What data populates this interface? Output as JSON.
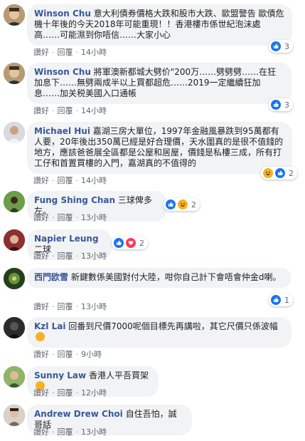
{
  "comments": [
    {
      "name": "Winson Chu",
      "text": "意大利債券價格大跌和股市大跌、歐盟警告 歐債危機十年後的今天2018年可能重現！！香港樓市係世紀泡沫處高……可能濕到你唔信……大家小心",
      "like": "讚好",
      "reply": "回覆",
      "time": "14小時",
      "reactions": [
        "like"
      ],
      "reaction_count": "3",
      "avatar_color": "#6b5a3a"
    },
    {
      "name": "Winson Chu",
      "text": "將軍澳新都城大劈价\"200万……劈劈劈……在狂加息下……無劈兩成半以上買都超危……2019一定繼續狂加息……加关税美國入口通帳",
      "like": "讚好",
      "reply": "回覆",
      "time": "14小時",
      "reactions": [
        "like"
      ],
      "reaction_count": "3",
      "avatar_color": "#6b5a3a"
    },
    {
      "name": "Michael Hui",
      "text": "嘉湖三房大單位，1997年金融風暴跌到95萬都有人要，20年後出350萬已經是好合理價，天水圍真的是很不值錢的地方，應該爸爸展全區都是公屋和居屋，價錢是私樓三成，所有打工仔和首置買樓的入門，嘉湖真的不值得的",
      "like": "讚好",
      "reply": "回覆",
      "time": "14小時",
      "reactions": [
        "haha",
        "like"
      ],
      "reaction_count": "2",
      "avatar_color": "#8a8f96"
    },
    {
      "name": "Fung Shing Chan",
      "text": "三球俾多左。",
      "like": "讚好",
      "reply": "回覆",
      "time": "13小時",
      "reactions": [
        "like",
        "haha"
      ],
      "reaction_count": "2",
      "avatar_color": "#4f7a3a"
    },
    {
      "name": "Napier Leung",
      "text": "二球",
      "like": "讚好",
      "reply": "回覆",
      "time": "13小時",
      "reactions": [
        "like",
        "love"
      ],
      "reaction_count": "2",
      "avatar_color": "#7a2a2a"
    },
    {
      "name": "西門欧雪",
      "text": "新鍵數係美國對付大陸，咁你自己計下會唔會仲金d喇。",
      "like": "讚好",
      "reply": "回覆",
      "time": "13小時",
      "reactions": [
        "like"
      ],
      "reaction_count": "1",
      "avatar_color": "#1f3a1a"
    },
    {
      "name": "Kzl Lai",
      "text": "回番到尺價7000呢個目標先再講啦，其它尺價只係波幅",
      "like": "讚好",
      "reply": "回覆",
      "time": "9小時",
      "reactions": [],
      "reaction_count": "",
      "avatar_color": "#2b2b2b"
    },
    {
      "name": "Sunny Law",
      "text": "香港人平吾買架",
      "like": "讚好",
      "reply": "回覆",
      "time": "12小時",
      "reactions": [],
      "reaction_count": "",
      "avatar_color": "#3f6b33"
    },
    {
      "name": "Andrew Drew Choi",
      "text": "自住吾怕，誠哥話",
      "like": "讚好",
      "reply": "回覆",
      "time": "13小時",
      "reactions": [],
      "reaction_count": "",
      "avatar_color": "#5a4a42"
    }
  ]
}
